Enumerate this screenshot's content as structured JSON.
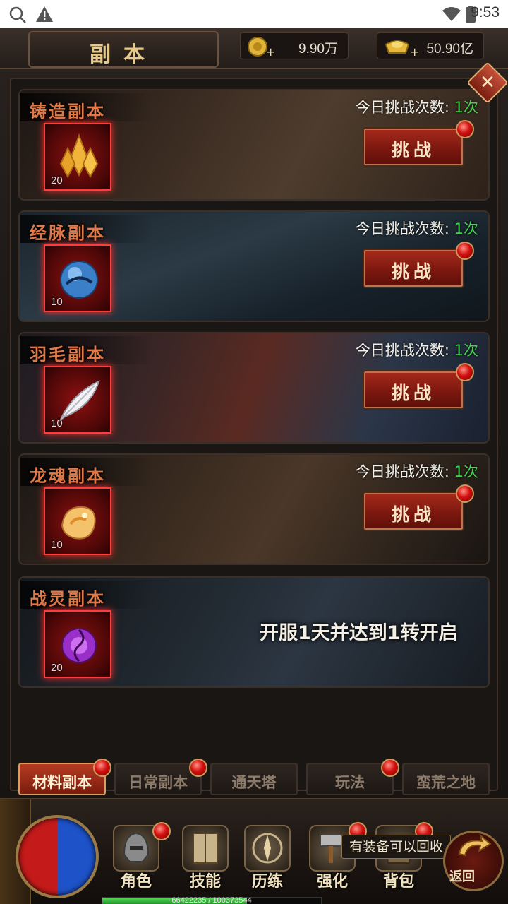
{
  "status_bar": {
    "time": "9:53"
  },
  "header": {
    "title": "副本",
    "gold": "9.90万",
    "ingot": "50.90亿"
  },
  "dungeons": [
    {
      "name": "铸造副本",
      "item_qty": "20",
      "item_icon": "gold-crystal-icon",
      "count_label": "今日挑战次数:",
      "count_value": "1次",
      "button_label": "挑战"
    },
    {
      "name": "经脉副本",
      "item_qty": "10",
      "item_icon": "blue-orb-icon",
      "count_label": "今日挑战次数:",
      "count_value": "1次",
      "button_label": "挑战"
    },
    {
      "name": "羽毛副本",
      "item_qty": "10",
      "item_icon": "white-feather-icon",
      "count_label": "今日挑战次数:",
      "count_value": "1次",
      "button_label": "挑战"
    },
    {
      "name": "龙魂副本",
      "item_qty": "10",
      "item_icon": "dragon-soul-icon",
      "count_label": "今日挑战次数:",
      "count_value": "1次",
      "button_label": "挑战"
    },
    {
      "name": "战灵副本",
      "item_qty": "20",
      "item_icon": "purple-spirit-orb-icon",
      "locked_text": "开服1天并达到1转开启"
    }
  ],
  "tabs": [
    {
      "label": "材料副本",
      "active": true,
      "dot": true
    },
    {
      "label": "日常副本",
      "active": false,
      "dot": true
    },
    {
      "label": "通天塔",
      "active": false,
      "dot": false
    },
    {
      "label": "玩法",
      "active": false,
      "dot": true
    },
    {
      "label": "蛮荒之地",
      "active": false,
      "dot": false
    }
  ],
  "bottom_nav": [
    {
      "label": "角色",
      "icon": "helmet-icon",
      "dot": true
    },
    {
      "label": "技能",
      "icon": "book-icon",
      "dot": false
    },
    {
      "label": "历练",
      "icon": "compass-icon",
      "dot": false
    },
    {
      "label": "强化",
      "icon": "hammer-icon",
      "dot": true
    },
    {
      "label": "背包",
      "icon": "bag-icon",
      "dot": true
    }
  ],
  "tooltip": "有装备可以回收",
  "return_label": "返回",
  "exp": {
    "text": "66422235 / 100373544",
    "fraction": 0.6617
  },
  "colors": {
    "accent_red": "#a72a1c",
    "count_green": "#3ed84c",
    "dungeon_name": "#e07a48"
  }
}
